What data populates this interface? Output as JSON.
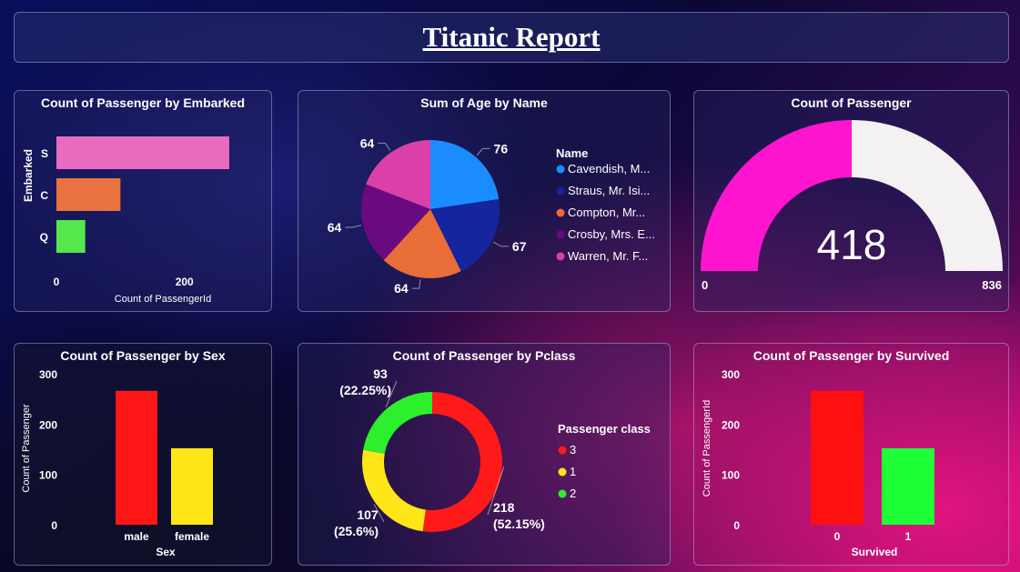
{
  "report": {
    "title": "Titanic Report"
  },
  "chart_data": [
    {
      "id": "embarked",
      "type": "bar",
      "orientation": "horizontal",
      "title": "Count of Passenger by Embarked",
      "xlabel": "Count of PassengerId",
      "ylabel": "Embarked",
      "categories": [
        "S",
        "C",
        "Q"
      ],
      "values": [
        270,
        100,
        45
      ],
      "colors": [
        "#e86bbf",
        "#e8733e",
        "#54e84a"
      ],
      "xlim": [
        0,
        280
      ],
      "xticks": [
        0,
        200
      ]
    },
    {
      "id": "age-by-name",
      "type": "pie",
      "title": "Sum of Age by Name",
      "legend_title": "Name",
      "labels": [
        "Cavendish, M...",
        "Straus, Mr. Isi...",
        "Compton, Mr...",
        "Crosby, Mrs. E...",
        "Warren, Mr. F..."
      ],
      "values": [
        76,
        67,
        64,
        64,
        64
      ],
      "colors": [
        "#1b8cff",
        "#14259e",
        "#e86d38",
        "#6a0a80",
        "#db40a8"
      ]
    },
    {
      "id": "passenger-count",
      "type": "gauge",
      "title": "Count of Passenger",
      "value": 418,
      "min": 0,
      "max": 836,
      "min_label": "0",
      "max_label": "836",
      "value_label": "418",
      "fill_color": "#ff14d0",
      "track_color": "#f3f1f1"
    },
    {
      "id": "sex",
      "type": "bar",
      "title": "Count of Passenger by Sex",
      "xlabel": "Sex",
      "ylabel": "Count of Passenger",
      "categories": [
        "male",
        "female"
      ],
      "values": [
        266,
        152
      ],
      "colors": [
        "#ff1616",
        "#ffe619"
      ],
      "ylim": [
        0,
        300
      ],
      "yticks": [
        0,
        100,
        200,
        300
      ]
    },
    {
      "id": "pclass",
      "type": "donut",
      "title": "Count of Passenger by Pclass",
      "legend_title": "Passenger class",
      "labels": [
        "3",
        "1",
        "2"
      ],
      "values": [
        218,
        107,
        93
      ],
      "percent_labels": [
        "(52.15%)",
        "(25.6%)",
        "(22.25%)"
      ],
      "colors": [
        "#ff1a1a",
        "#ffe619",
        "#2bf02b"
      ]
    },
    {
      "id": "survived",
      "type": "bar",
      "title": "Count of Passenger by Survived",
      "xlabel": "Survived",
      "ylabel": "Count of PassengerId",
      "categories": [
        "0",
        "1"
      ],
      "values": [
        266,
        152
      ],
      "colors": [
        "#ff1010",
        "#1fff37"
      ],
      "ylim": [
        0,
        300
      ],
      "yticks": [
        0,
        100,
        200,
        300
      ]
    }
  ]
}
